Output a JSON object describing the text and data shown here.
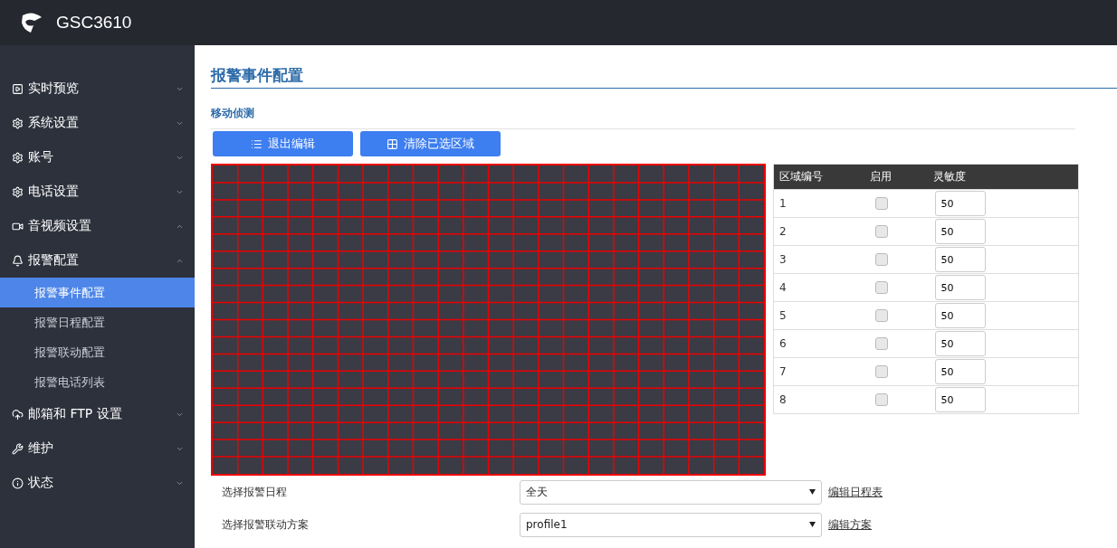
{
  "header": {
    "title": "GSC3610"
  },
  "sidebar": {
    "items": [
      {
        "label": "实时预览",
        "expanded": false
      },
      {
        "label": "系统设置",
        "expanded": false
      },
      {
        "label": "账号",
        "expanded": false
      },
      {
        "label": "电话设置",
        "expanded": false
      },
      {
        "label": "音视频设置",
        "expanded": true
      },
      {
        "label": "报警配置",
        "expanded": true,
        "children": [
          {
            "label": "报警事件配置",
            "selected": true
          },
          {
            "label": "报警日程配置",
            "selected": false
          },
          {
            "label": "报警联动配置",
            "selected": false
          },
          {
            "label": "报警电话列表",
            "selected": false
          }
        ]
      },
      {
        "label": "邮箱和 FTP 设置",
        "expanded": false
      },
      {
        "label": "维护",
        "expanded": false
      },
      {
        "label": "状态",
        "expanded": false
      }
    ]
  },
  "page": {
    "title": "报警事件配置",
    "section": "移动侦测",
    "buttons": [
      {
        "label": "退出编辑"
      },
      {
        "label": "清除已选区域"
      }
    ],
    "zone_table": {
      "columns": [
        "区域编号",
        "启用",
        "灵敏度"
      ],
      "rows": [
        {
          "zone": "1",
          "checked": false,
          "sensitivity": "50"
        },
        {
          "zone": "2",
          "checked": false,
          "sensitivity": "50"
        },
        {
          "zone": "3",
          "checked": false,
          "sensitivity": "50"
        },
        {
          "zone": "4",
          "checked": false,
          "sensitivity": "50"
        },
        {
          "zone": "5",
          "checked": false,
          "sensitivity": "50"
        },
        {
          "zone": "6",
          "checked": false,
          "sensitivity": "50"
        },
        {
          "zone": "7",
          "checked": false,
          "sensitivity": "50"
        },
        {
          "zone": "8",
          "checked": false,
          "sensitivity": "50"
        }
      ]
    },
    "form": [
      {
        "label": "选择报警日程",
        "value": "全天",
        "link": "编辑日程表"
      },
      {
        "label": "选择报警联动方案",
        "value": "profile1",
        "link": "编辑方案"
      }
    ]
  }
}
